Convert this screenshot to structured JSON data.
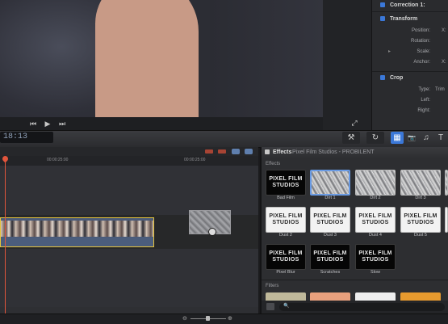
{
  "viewer": {
    "controls": {
      "prev": "⏮",
      "play": "▶",
      "next": "⏭",
      "fullscreen": "⤢"
    }
  },
  "inspector": {
    "correction_title": "Correction 1:",
    "transform_title": "Transform",
    "position_label": "Position:",
    "position_axis": "X:",
    "rotation_label": "Rotation:",
    "scale_label": "Scale:",
    "anchor_label": "Anchor:",
    "anchor_axis": "X:",
    "crop_title": "Crop",
    "type_label": "Type:",
    "type_value": "Trim",
    "left_label": "Left:",
    "right_label": "Right:"
  },
  "toolbar": {
    "timecode": "18:13",
    "tool_icon": "⚒",
    "retime_icon": "↻",
    "media_icon": "▦",
    "camera_icon": "📷",
    "music_icon": "♫",
    "text_icon": "T"
  },
  "timeline": {
    "ruler_marks": [
      "00:00:25:00",
      "00:00:25:00"
    ]
  },
  "effects": {
    "header_title": "Effects",
    "header_path": "Pixel Film Studios - PROBILENT",
    "section_effects": "Effects",
    "section_filters": "Filters",
    "logo_line1": "PIXEL FILM",
    "logo_line2": "STUDIOS",
    "row1": [
      "Bad Film",
      "Dirt 1",
      "Dirt 2",
      "Dirt 3"
    ],
    "row2": [
      "Dust 2",
      "Dust 3",
      "Dust 4",
      "Dust 5"
    ],
    "row3": [
      "Pixel Blur",
      "Scratches",
      "Slow"
    ],
    "search_icon": "🔍"
  },
  "colors": {
    "accent_blue": "#3b78d8",
    "playhead": "#e2553c",
    "clip_border": "#e5c33c"
  }
}
